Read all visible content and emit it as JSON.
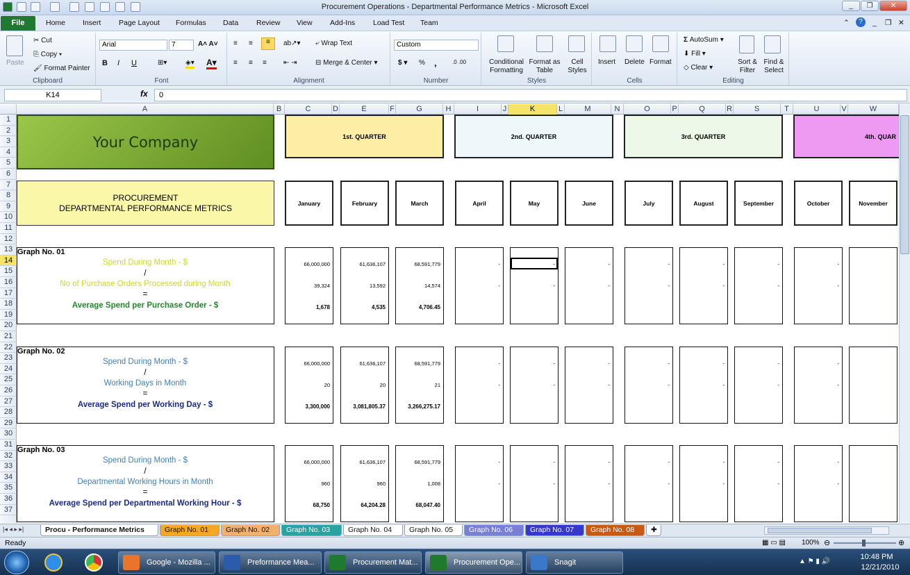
{
  "window": {
    "title": "Procurement Operations - Departmental Performance Metrics  -  Microsoft Excel"
  },
  "ribbon_tabs": [
    "File",
    "Home",
    "Insert",
    "Page Layout",
    "Formulas",
    "Data",
    "Review",
    "View",
    "Add-Ins",
    "Load Test",
    "Team"
  ],
  "ribbon": {
    "clipboard": {
      "label": "Clipboard",
      "paste": "Paste",
      "cut": "Cut",
      "copy": "Copy",
      "format_painter": "Format Painter"
    },
    "font": {
      "label": "Font",
      "family": "Arial",
      "size": "7",
      "bold": "B",
      "italic": "I",
      "underline": "U"
    },
    "alignment": {
      "label": "Alignment",
      "wrap": "Wrap Text",
      "merge": "Merge & Center"
    },
    "number": {
      "label": "Number",
      "format": "Custom",
      "currency": "$",
      "percent": "%",
      "comma": ","
    },
    "styles": {
      "label": "Styles",
      "conditional": "Conditional Formatting",
      "format_table": "Format as Table",
      "cell_styles": "Cell Styles"
    },
    "cells": {
      "label": "Cells",
      "insert": "Insert",
      "delete": "Delete",
      "format": "Format"
    },
    "editing": {
      "label": "Editing",
      "autosum": "AutoSum",
      "fill": "Fill",
      "clear": "Clear",
      "sort": "Sort & Filter",
      "find": "Find & Select"
    }
  },
  "formula_bar": {
    "name_box": "K14",
    "fx": "fx",
    "value": "0"
  },
  "columns": [
    "A",
    "B",
    "C",
    "D",
    "E",
    "F",
    "G",
    "H",
    "I",
    "J",
    "K",
    "L",
    "M",
    "N",
    "O",
    "P",
    "Q",
    "R",
    "S",
    "T",
    "U",
    "V",
    "W"
  ],
  "rows": [
    "1",
    "2",
    "3",
    "4",
    "5",
    "6",
    "7",
    "8",
    "9",
    "10",
    "11",
    "12",
    "13",
    "14",
    "15",
    "16",
    "17",
    "18",
    "19",
    "20",
    "21",
    "22",
    "23",
    "24",
    "25",
    "26",
    "27",
    "28",
    "29",
    "30",
    "31",
    "32",
    "33",
    "34",
    "35",
    "36",
    "37"
  ],
  "sheet": {
    "company": "Your Company",
    "header_line1": "PROCUREMENT",
    "header_line2": "DEPARTMENTAL PERFORMANCE METRICS",
    "quarters": [
      "1st. QUARTER",
      "2nd. QUARTER",
      "3rd. QUARTER",
      "4th. QUAR"
    ],
    "months": [
      "January",
      "February",
      "March",
      "April",
      "May",
      "June",
      "July",
      "August",
      "September",
      "October",
      "November"
    ],
    "graphs": [
      {
        "title": "Graph No. 01",
        "line1": "Spend During Month  - $",
        "op1": "/",
        "line2": "No of Purchase Orders Processed during Month",
        "op2": "=",
        "result": "Average Spend per Purchase Order - $",
        "v1": [
          "66,000,000",
          "61,636,107",
          "68,591,779"
        ],
        "v2": [
          "39,324",
          "13,592",
          "14,574"
        ],
        "r": [
          "1,678",
          "4,535",
          "4,706.45"
        ]
      },
      {
        "title": "Graph No. 02",
        "line1": "Spend During Month  - $",
        "op1": "/",
        "line2": "Working Days in Month",
        "op2": "=",
        "result": "Average Spend per Working Day - $",
        "v1": [
          "66,000,000",
          "61,636,107",
          "68,591,779"
        ],
        "v2": [
          "20",
          "20",
          "21"
        ],
        "r": [
          "3,300,000",
          "3,081,805.37",
          "3,266,275.17"
        ]
      },
      {
        "title": "Graph No. 03",
        "line1": "Spend During Month  - $",
        "op1": "/",
        "line2": "Departmental Working Hours in Month",
        "op2": "=",
        "result": "Average Spend per Departmental Working Hour - $",
        "v1": [
          "66,000,000",
          "61,636,107",
          "68,591,779"
        ],
        "v2": [
          "960",
          "960",
          "1,008"
        ],
        "r": [
          "68,750",
          "64,204.28",
          "68,047.40"
        ]
      }
    ],
    "empty_dash": "-"
  },
  "sheet_tabs": [
    {
      "label": "Procu - Performance Metrics",
      "color": "#ffffff"
    },
    {
      "label": "Graph No. 01",
      "color": "#f5a623"
    },
    {
      "label": "Graph No. 02",
      "color": "#f2b06b"
    },
    {
      "label": "Graph No. 03",
      "color": "#2aa3a0"
    },
    {
      "label": "Graph No. 04",
      "color": "#ffffff"
    },
    {
      "label": "Graph No. 05",
      "color": "#ffffff"
    },
    {
      "label": "Graph No. 06",
      "color": "#7a7fd6"
    },
    {
      "label": "Graph No. 07",
      "color": "#3538c8"
    },
    {
      "label": "Graph No. 08",
      "color": "#c85a14"
    }
  ],
  "status": {
    "ready": "Ready",
    "zoom": "100%"
  },
  "taskbar": {
    "items": [
      "Google - Mozilla ...",
      "Preformance Mea...",
      "Procurement Mat...",
      "Procurement Ope...",
      "Snagit"
    ],
    "time": "10:48 PM",
    "date": "12/21/2010"
  }
}
